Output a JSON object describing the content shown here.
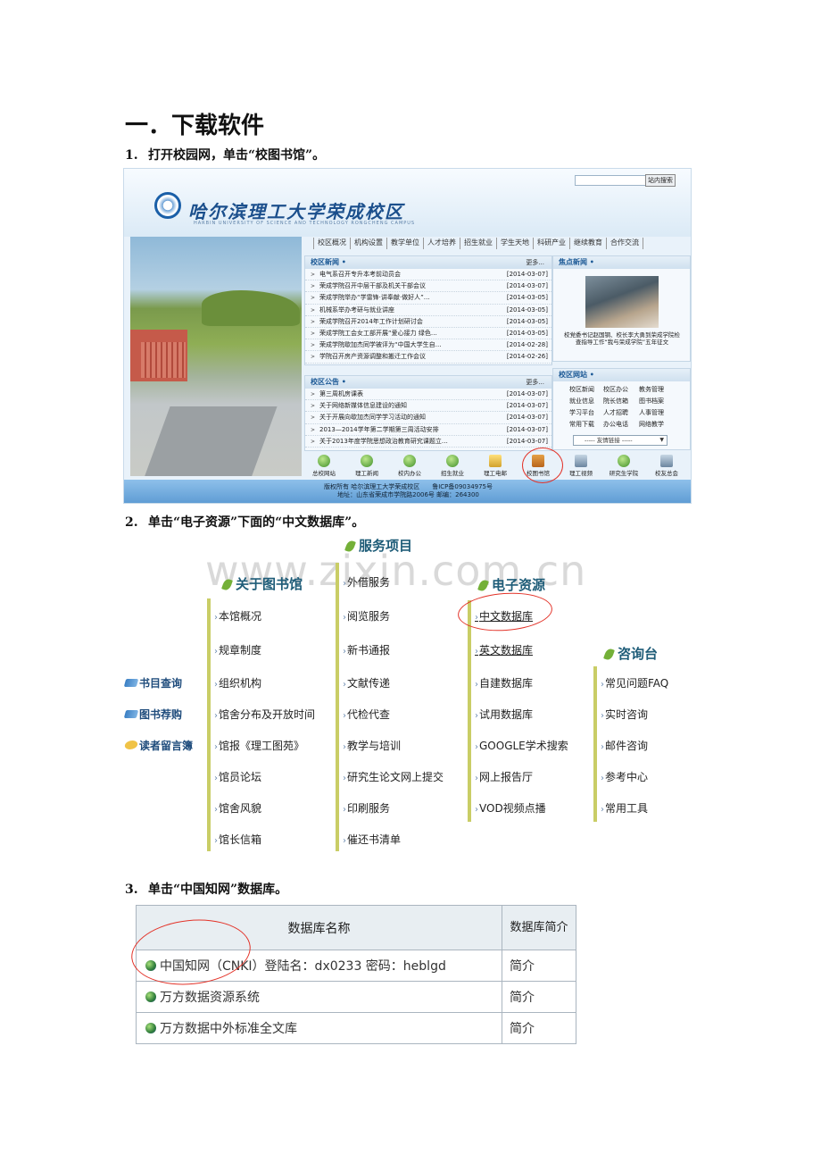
{
  "heading": "一．下载软件",
  "steps": [
    {
      "num": "1.",
      "text": "打开校园网，单击“校图书馆”。"
    },
    {
      "num": "2.",
      "text": "单击“电子资源”下面的“中文数据库”。"
    },
    {
      "num": "3.",
      "text": "单击“中国知网”数据库。"
    }
  ],
  "site": {
    "search_button": "站内搜索",
    "title": "哈尔滨理工大学荣成校区",
    "subtitle": "HARBIN UNIVERSITY OF SCIENCE AND TECHNOLOGY RONGCHENG CAMPUS",
    "nav": [
      "校区概况",
      "机构设置",
      "教学单位",
      "人才培养",
      "招生就业",
      "学生天地",
      "科研产业",
      "继续教育",
      "合作交流"
    ],
    "news": {
      "title": "校区新闻 •",
      "more": "更多...",
      "items": [
        {
          "text": "电气系召开专升本考前动员会",
          "date": "[2014-03-07]"
        },
        {
          "text": "荣成学院召开中层干部及机关干部会议",
          "date": "[2014-03-07]"
        },
        {
          "text": "荣成学院举办“学雷锋·讲奉献·做好人”…",
          "date": "[2014-03-05]"
        },
        {
          "text": "机械系举办考研与就业讲座",
          "date": "[2014-03-05]"
        },
        {
          "text": "荣成学院召开2014年工作计划研讨会",
          "date": "[2014-03-05]"
        },
        {
          "text": "荣成学院工会女工部开展“爱心接力 绿色…",
          "date": "[2014-03-05]"
        },
        {
          "text": "荣成学院歇加杰同学被评为“中国大学生自…",
          "date": "[2014-02-28]"
        },
        {
          "text": "学院召开房产资源调整和搬迁工作会议",
          "date": "[2014-02-26]"
        }
      ]
    },
    "notices": {
      "title": "校区公告 •",
      "more": "更多...",
      "items": [
        {
          "text": "第三周机房课表",
          "date": "[2014-03-07]"
        },
        {
          "text": "关于网络新媒体信息建设的通知",
          "date": "[2014-03-07]"
        },
        {
          "text": "关于开展向歇加杰同学学习活动的通知",
          "date": "[2014-03-07]"
        },
        {
          "text": "2013—2014学年第二学期第三周活动安排",
          "date": "[2014-03-07]"
        },
        {
          "text": "关于2013年度学院思想政治教育研究课题立…",
          "date": "[2014-03-07]"
        }
      ]
    },
    "focus": {
      "title": "焦点新闻 •",
      "caption": "校党委书记赵国钢、校长李大勇到荣成学院检查指导工作“我与荣成学院”五年征文"
    },
    "links": {
      "title": "校区网站 •",
      "items": [
        "校区新闻",
        "校区办公",
        "教务管理",
        "就业信息",
        "院长信箱",
        "图书档案",
        "学习平台",
        "人才招聘",
        "人事管理",
        "常用下载",
        "办公电话",
        "网络教学"
      ],
      "friend_select": "----- 友情链接 -----"
    },
    "icons": [
      "总校网站",
      "理工新闻",
      "校内办公",
      "招生就业",
      "理工电邮",
      "校图书馆",
      "理工视频",
      "研究生学院",
      "校友总会"
    ],
    "footer_line1": "版权所有 哈尔滨理工大学荣成校区　　鲁ICP备09034975号",
    "footer_line2": "地址：山东省荣成市学院路2006号  邮编：264300"
  },
  "watermark": "www.zixin.com.cn",
  "library": {
    "service_title": "服务项目",
    "about_title": "关于图书馆",
    "eres_title": "电子资源",
    "consult_title": "咨询台",
    "side_links": [
      "书目查询",
      "图书荐购",
      "读者留言簿"
    ],
    "about_items": [
      "本馆概况",
      "规章制度",
      "组织机构",
      "馆舍分布及开放时间",
      "馆报《理工图苑》",
      "馆员论坛",
      "馆舍风貌",
      "馆长信箱"
    ],
    "service_items": [
      "外借服务",
      "阅览服务",
      "新书通报",
      "文献传递",
      "代检代查",
      "教学与培训",
      "研究生论文网上提交",
      "印刷服务",
      "催还书清单"
    ],
    "eres_items": [
      "中文数据库",
      "英文数据库",
      "自建数据库",
      "试用数据库",
      "GOOGLE学术搜索",
      "网上报告厅",
      "VOD视频点播"
    ],
    "consult_items": [
      "常见问题FAQ",
      "实时咨询",
      "邮件咨询",
      "参考中心",
      "常用工具"
    ]
  },
  "db_table": {
    "col1": "数据库名称",
    "col2": "数据库简介",
    "rows": [
      {
        "name": "中国知网（CNKI）登陆名：dx0233 密码：heblgd",
        "intro": "简介"
      },
      {
        "name": "万方数据资源系统",
        "intro": "简介"
      },
      {
        "name": "万方数据中外标准全文库",
        "intro": "简介"
      }
    ]
  },
  "colors": {
    "annotation_red": "#e3342a",
    "section_title": "#1e5c78",
    "leaf_green": "#74b038",
    "menu_bar": "#c9cd66"
  }
}
